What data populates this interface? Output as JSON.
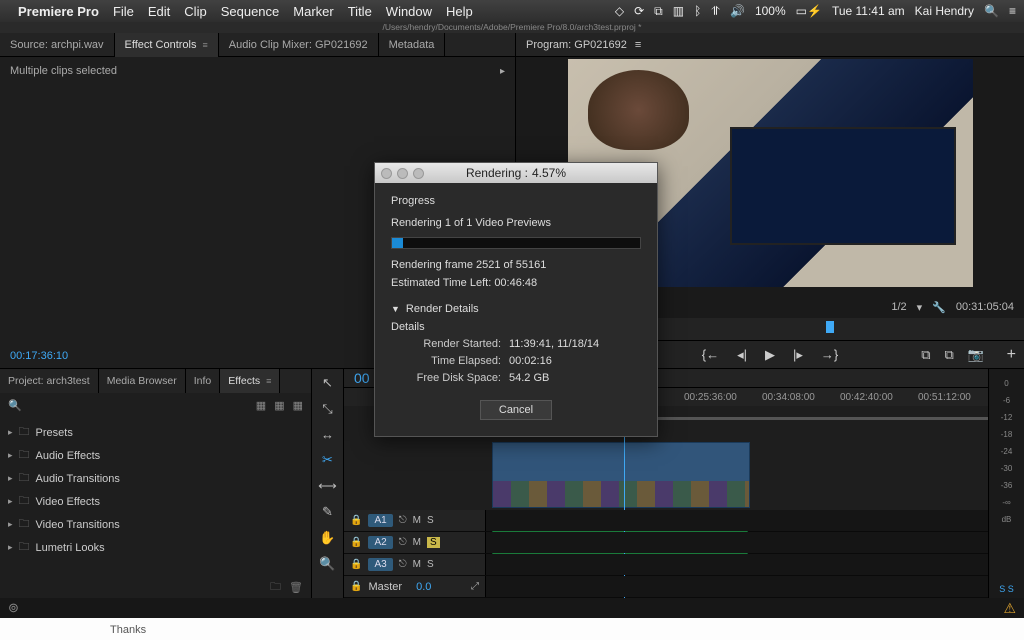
{
  "menubar": {
    "app": "Premiere Pro",
    "items": [
      "File",
      "Edit",
      "Clip",
      "Sequence",
      "Marker",
      "Title",
      "Window",
      "Help"
    ],
    "battery": "100%",
    "clock": "Tue 11:41 am",
    "user": "Kai Hendry"
  },
  "pathbar": "/Users/hendry/Documents/Adobe/Premiere Pro/8.0/arch3test.prproj *",
  "source_tabs": {
    "source": "Source: archpi.wav",
    "effect_controls": "Effect Controls",
    "audio_mixer": "Audio Clip Mixer: GP021692",
    "metadata": "Metadata"
  },
  "effect_controls": {
    "multiclip": "Multiple clips selected",
    "timecode": "00:17:36:10"
  },
  "program": {
    "label": "Program: GP021692",
    "zoom": "1/2",
    "duration": "00:31:05:04"
  },
  "project_tabs": {
    "project": "Project: arch3test",
    "media": "Media Browser",
    "info": "Info",
    "effects": "Effects"
  },
  "effects_tree": [
    "Presets",
    "Audio Effects",
    "Audio Transitions",
    "Video Effects",
    "Video Transitions",
    "Lumetri Looks"
  ],
  "timeline": {
    "timecode": "00",
    "ticks": [
      "00",
      "00:25:36:00",
      "00:34:08:00",
      "00:42:40:00",
      "00:51:12:00"
    ],
    "tracks": {
      "a1": "A1",
      "a2": "A2",
      "a3": "A3",
      "master": "Master",
      "master_val": "0.0"
    }
  },
  "meters": [
    "0",
    "-6",
    "-12",
    "-18",
    "-24",
    "-30",
    "-36",
    "-∞",
    "dB"
  ],
  "meters_foot": "S   S",
  "dialog": {
    "title_prefix": "Rendering : ",
    "percent": "4.57%",
    "progress_label": "Progress",
    "status": "Rendering 1 of 1 Video Previews",
    "frame": "Rendering frame 2521 of 55161",
    "eta": "Estimated Time Left: 00:46:48",
    "details_label": "Render Details",
    "details_sub": "Details",
    "started_lbl": "Render Started:",
    "started_val": "11:39:41, 11/18/14",
    "elapsed_lbl": "Time Elapsed:",
    "elapsed_val": "00:02:16",
    "disk_lbl": "Free Disk Space:",
    "disk_val": "54.2 GB",
    "cancel": "Cancel"
  },
  "below_text": "Thanks"
}
